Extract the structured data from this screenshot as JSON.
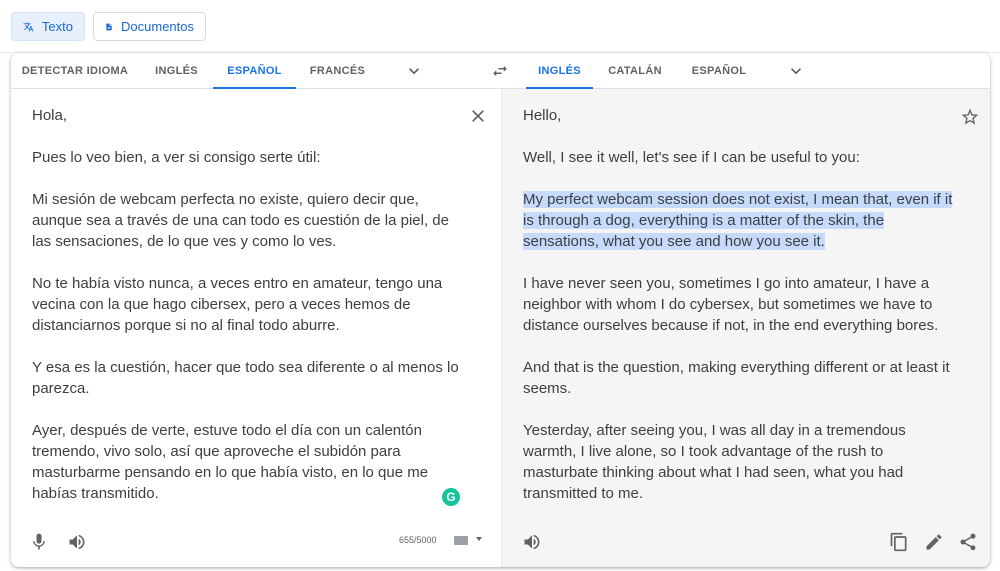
{
  "modes": {
    "text_label": "Texto",
    "docs_label": "Documentos"
  },
  "source_langs": [
    {
      "label": "DETECTAR IDIOMA",
      "active": false
    },
    {
      "label": "INGLÉS",
      "active": false
    },
    {
      "label": "ESPAÑOL",
      "active": true
    },
    {
      "label": "FRANCÉS",
      "active": false
    }
  ],
  "target_langs": [
    {
      "label": "INGLÉS",
      "active": true
    },
    {
      "label": "CATALÁN",
      "active": false
    },
    {
      "label": "ESPAÑOL",
      "active": false
    }
  ],
  "source": {
    "paragraphs": [
      "Hola,",
      "Pues lo veo bien, a ver si consigo serte útil:",
      "Mi sesión de webcam perfecta no existe, quiero decir que, aunque sea a través de una can todo es cuestión de la piel, de las sensaciones, de lo que ves y como lo ves.",
      "No te había visto nunca, a veces entro en amateur, tengo una vecina con la que hago cibersex, pero a veces hemos de distanciarnos porque si no al final todo aburre.",
      "Y esa es la cuestión, hacer que todo sea diferente o al menos lo parezca.",
      "Ayer, después de verte, estuve todo el día con un calentón tremendo, vivo solo, así que aproveche el subidón para masturbarme pensando en lo que había visto, en lo que me habías transmitido."
    ],
    "char_count": "655/5000"
  },
  "target": {
    "paragraphs": [
      "Hello,",
      "Well, I see it well, let's see if I can be useful to you:",
      "My perfect webcam session does not exist, I mean that, even if it is through a dog, everything is a matter of the skin, the sensations, what you see and how you see it.",
      "I have never seen you, sometimes I go into amateur, I have a neighbor with whom I do cybersex, but sometimes we have to distance ourselves because if not, in the end everything bores.",
      "And that is the question, making everything different or at least it seems.",
      "Yesterday, after seeing you, I was all day in a tremendous warmth, I live alone, so I took advantage of the rush to masturbate thinking about what I had seen, what you had transmitted to me."
    ]
  },
  "colors": {
    "accent": "#1a73e8",
    "highlight": "#c6dafc",
    "target_bg": "#f5f5f5"
  }
}
